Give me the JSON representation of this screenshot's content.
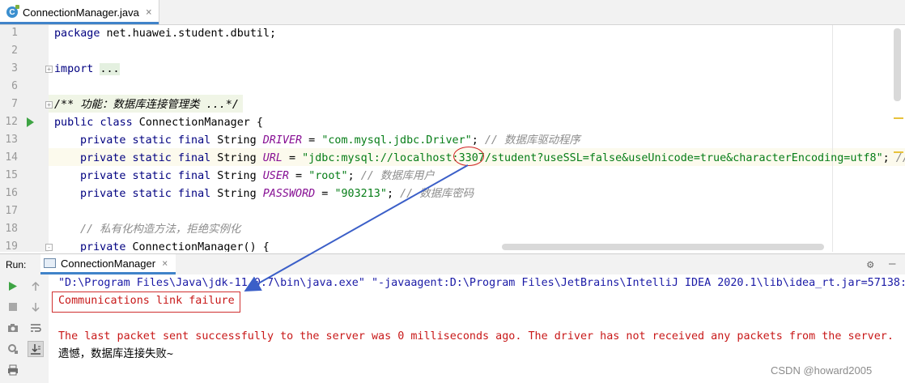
{
  "tab": {
    "label": "ConnectionManager.java",
    "close": "×"
  },
  "editor": {
    "line_numbers": [
      "1",
      "2",
      "3",
      "6",
      "7",
      "12",
      "13",
      "14",
      "15",
      "16",
      "17",
      "18",
      "19"
    ],
    "line1": {
      "kw": "package",
      "rest": " net.huawei.student.dbutil;"
    },
    "line3": {
      "kw": "import",
      "folded": "..."
    },
    "line7": {
      "text": "/** 功能：数据库连接管理类 ...*/"
    },
    "line12": {
      "kw1": "public",
      "kw2": "class",
      "rest": " ConnectionManager {"
    },
    "line13": {
      "mods": "private static final",
      "type": " String ",
      "name": "DRIVER",
      "eq": " = ",
      "value": "\"com.mysql.jdbc.Driver\"",
      "end": "; ",
      "comment": "// 数据库驱动程序"
    },
    "line14": {
      "mods": "private static final",
      "type": " String ",
      "name": "URL",
      "eq": " = ",
      "value": "\"jdbc:mysql://localhost:3307/student?useSSL=false&useUnicode=true&characterEncoding=utf8\"",
      "end": "; ",
      "comment": "//"
    },
    "line15": {
      "mods": "private static final",
      "type": " String ",
      "name": "USER",
      "eq": " = ",
      "value": "\"root\"",
      "end": "; ",
      "comment": "// 数据库用户"
    },
    "line16": {
      "mods": "private static final",
      "type": " String ",
      "name": "PASSWORD",
      "eq": " = ",
      "value": "\"903213\"",
      "end": "; ",
      "comment": "// 数据库密码"
    },
    "line18": {
      "comment": "// 私有化构造方法，拒绝实例化"
    },
    "line19": {
      "kw": "private",
      "rest": " ConnectionManager() {"
    }
  },
  "run": {
    "label": "Run:",
    "tab_label": "ConnectionManager",
    "tab_close": "×",
    "gear": "⚙",
    "minimize": "—",
    "console": {
      "cmd": "\"D:\\Program Files\\Java\\jdk-11.0.7\\bin\\java.exe\" \"-javaagent:D:\\Program Files\\JetBrains\\IntelliJ IDEA 2020.1\\lib\\idea_rt.jar=57138:D",
      "error1": "Communications link failure",
      "error2": "The last packet sent successfully to the server was 0 milliseconds ago. The driver has not received any packets from the server.",
      "output": "遗憾，数据库连接失败~"
    }
  },
  "watermark": "CSDN @howard2005",
  "colors": {
    "keyword": "#000080",
    "string": "#067d17",
    "field": "#871094",
    "comment": "#8c8c8c",
    "error": "#c81818",
    "annotation": "#d02020",
    "arrow": "#3b5fc8"
  },
  "icons": [
    "java-class-icon",
    "run-gutter-icon",
    "rerun-icon",
    "stop-icon",
    "camera-icon",
    "settings-icon",
    "up-arrow-icon",
    "down-arrow-icon",
    "soft-wrap-icon",
    "scroll-to-end-icon",
    "print-icon",
    "gear-icon",
    "minimize-icon"
  ]
}
